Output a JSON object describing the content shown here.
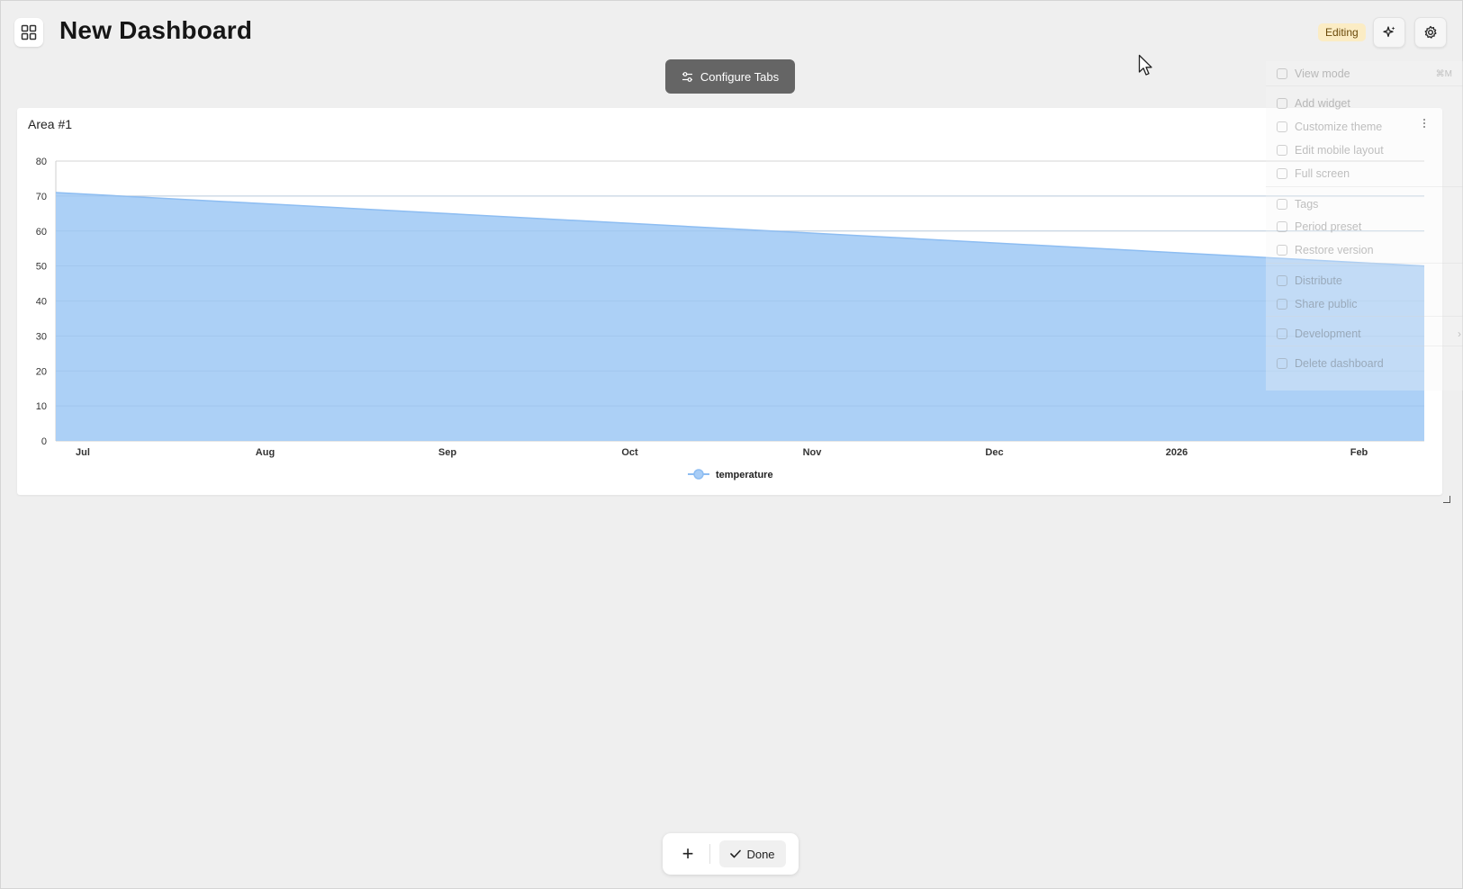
{
  "header": {
    "title": "New Dashboard",
    "mode_badge": "Editing",
    "configure_tabs_label": "Configure Tabs"
  },
  "widget": {
    "title": "Area #1"
  },
  "menu": {
    "items": [
      {
        "label": "View mode",
        "shortcut": "⌘M",
        "icon": "eye-icon"
      },
      {
        "label": "Add widget",
        "icon": "plus-icon"
      },
      {
        "label": "Customize theme",
        "icon": "palette-icon"
      },
      {
        "label": "Edit mobile layout",
        "icon": "mobile-icon"
      },
      {
        "label": "Full screen",
        "icon": "expand-icon"
      },
      {
        "label": "Tags",
        "icon": "tag-icon"
      },
      {
        "label": "Period preset",
        "icon": "calendar-icon"
      },
      {
        "label": "Restore version",
        "icon": "history-icon"
      },
      {
        "label": "Distribute",
        "icon": "share-nodes-icon"
      },
      {
        "label": "Share public",
        "icon": "globe-icon"
      },
      {
        "label": "Development",
        "icon": "bug-icon",
        "submenu": true
      },
      {
        "label": "Delete dashboard",
        "icon": "trash-icon"
      }
    ]
  },
  "toolbar": {
    "add_label": "+",
    "done_label": "Done"
  },
  "colors": {
    "area_fill": "#a8cdf6",
    "area_stroke": "#8dbdf2",
    "badge_bg": "#fbecc4"
  },
  "chart_data": {
    "type": "area",
    "x": [
      "Jul",
      "Aug",
      "Sep",
      "Oct",
      "Nov",
      "Dec",
      "2026",
      "Feb"
    ],
    "series": [
      {
        "name": "temperature",
        "start": 71,
        "end": 50
      }
    ],
    "ylim": [
      0,
      80
    ],
    "yticks": [
      0,
      10,
      20,
      30,
      40,
      50,
      60,
      70,
      80
    ],
    "grid": true,
    "legend": "bottom"
  }
}
